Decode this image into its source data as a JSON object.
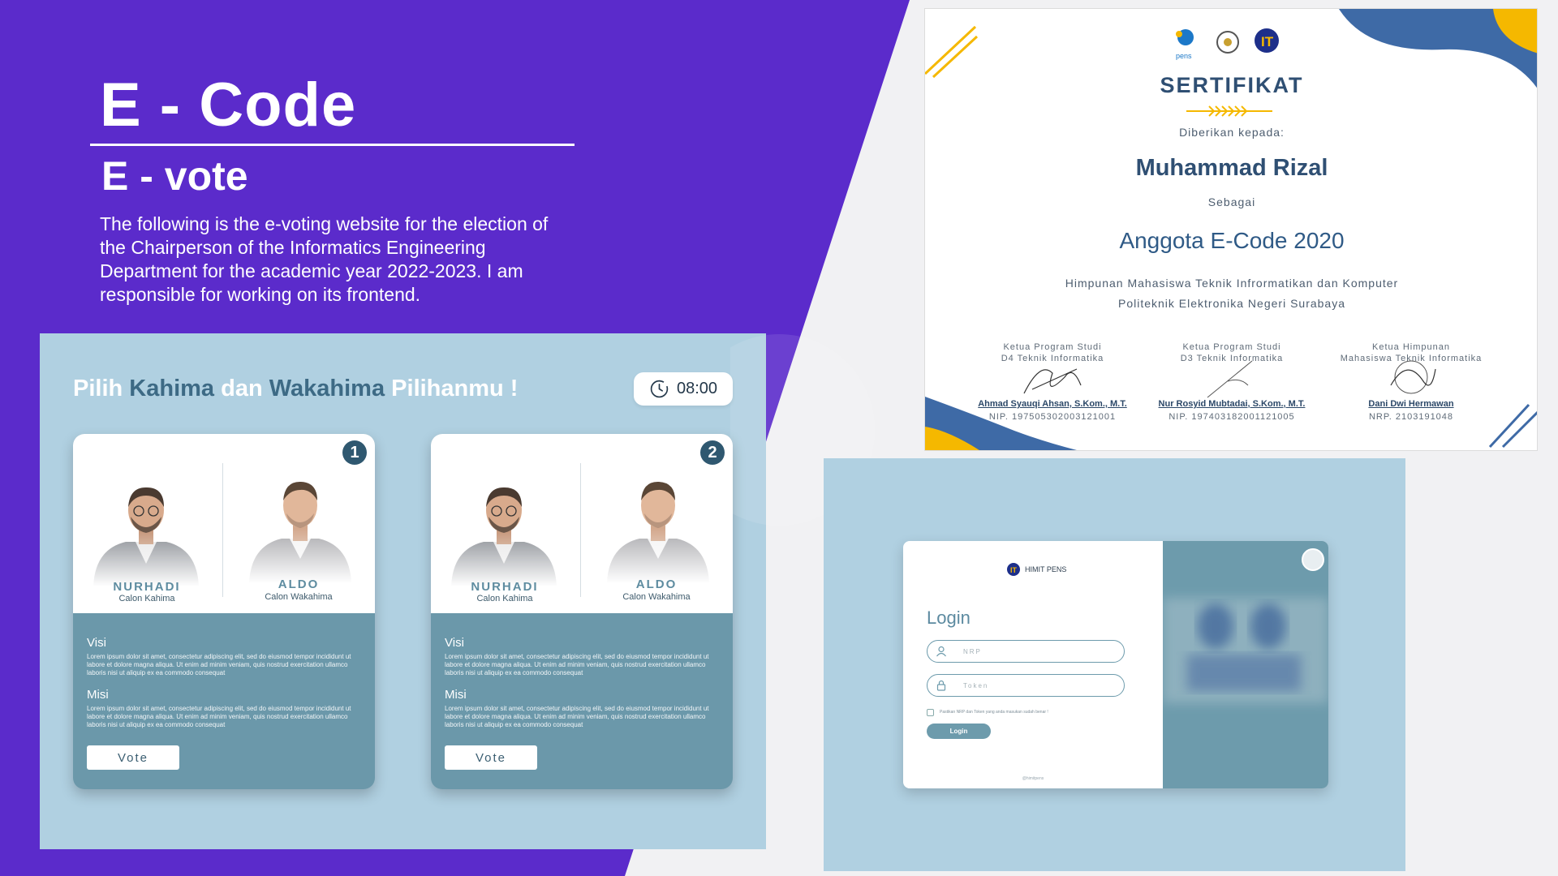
{
  "intro": {
    "title": "E - Code",
    "subtitle": "E - vote",
    "description": "The following is the e-voting website for the election of the Chairperson of the Informatics Engineering Department for the academic year 2022-2023. I am responsible for working on its frontend."
  },
  "vote": {
    "heading_parts": [
      "Pilih ",
      "Kahima",
      " dan ",
      "Wakahima",
      " Pilihanmu !"
    ],
    "timer": "08:00",
    "cards": [
      {
        "number": "1",
        "kahima_name": "NURHADI",
        "kahima_role": "Calon Kahima",
        "wakahima_name": "ALDO",
        "wakahima_role": "Calon Wakahima",
        "visi_label": "Visi",
        "visi_text": "Lorem ipsum dolor sit amet, consectetur adipiscing elit, sed do eiusmod tempor incididunt ut labore et dolore magna aliqua. Ut enim ad minim veniam, quis nostrud exercitation ullamco laboris nisi ut aliquip ex ea commodo consequat",
        "misi_label": "Misi",
        "misi_text": "Lorem ipsum dolor sit amet, consectetur adipiscing elit, sed do eiusmod tempor incididunt ut labore et dolore magna aliqua. Ut enim ad minim veniam, quis nostrud exercitation ullamco laboris nisi ut aliquip ex ea commodo consequat",
        "vote_label": "Vote"
      },
      {
        "number": "2",
        "kahima_name": "NURHADI",
        "kahima_role": "Calon Kahima",
        "wakahima_name": "ALDO",
        "wakahima_role": "Calon Wakahima",
        "visi_label": "Visi",
        "visi_text": "Lorem ipsum dolor sit amet, consectetur adipiscing elit, sed do eiusmod tempor incididunt ut labore et dolore magna aliqua. Ut enim ad minim veniam, quis nostrud exercitation ullamco laboris nisi ut aliquip ex ea commodo consequat",
        "misi_label": "Misi",
        "misi_text": "Lorem ipsum dolor sit amet, consectetur adipiscing elit, sed do eiusmod tempor incididunt ut labore et dolore magna aliqua. Ut enim ad minim veniam, quis nostrud exercitation ullamco laboris nisi ut aliquip ex ea commodo consequat",
        "vote_label": "Vote"
      }
    ]
  },
  "certificate": {
    "title": "SERTIFIKAT",
    "given_to": "Diberikan kepada:",
    "name": "Muhammad Rizal",
    "as": "Sebagai",
    "role": "Anggota E-Code 2020",
    "org_line1": "Himpunan Mahasiswa Teknik Infrormatikan dan Komputer",
    "org_line2": "Politeknik Elektronika Negeri Surabaya",
    "signatories": [
      {
        "pos1": "Ketua Program Studi",
        "pos2": "D4 Teknik Informatika",
        "name": "Ahmad Syauqi Ahsan, S.Kom., M.T.",
        "id": "NIP. 197505302003121001"
      },
      {
        "pos1": "Ketua Program Studi",
        "pos2": "D3 Teknik Informatika",
        "name": "Nur Rosyid Mubtadai, S.Kom., M.T.",
        "id": "NIP. 197403182001121005"
      },
      {
        "pos1": "Ketua Himpunan",
        "pos2": "Mahasiswa Teknik Informatika",
        "name": "Dani Dwi Hermawan",
        "id": "NRP. 2103191048"
      }
    ]
  },
  "login": {
    "brand": "HIMIT PENS",
    "title": "Login",
    "nrp_placeholder": "NRP",
    "token_placeholder": "Token",
    "note": "Pastikan NRP dan Token yang anda masukan sudah benar !",
    "button": "Login",
    "footer": "@himitpens"
  },
  "colors": {
    "purple": "#5b2bcb",
    "vote_panel": "#b0d0e1",
    "card_body": "#6b98aa",
    "accent_dark": "#3d6a85",
    "cert_navy": "#2f4f73",
    "cert_yellow": "#f5b800"
  }
}
